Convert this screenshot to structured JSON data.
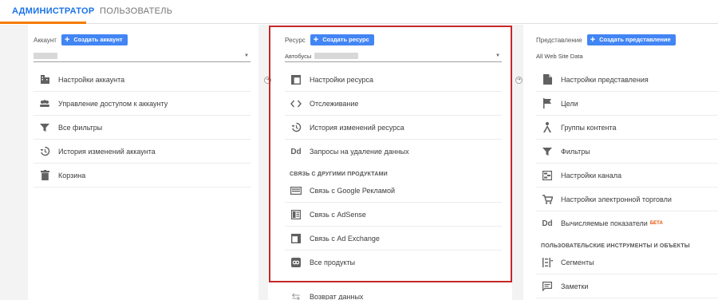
{
  "tabs": {
    "admin": "АДМИНИСТРАТОР",
    "user": "ПОЛЬЗОВАТЕЛЬ"
  },
  "account": {
    "title": "Аккаунт",
    "create_label": "Создать аккаунт",
    "items": [
      {
        "label": "Настройки аккаунта",
        "icon": "building-icon"
      },
      {
        "label": "Управление доступом к аккаунту",
        "icon": "people-icon"
      },
      {
        "label": "Все фильтры",
        "icon": "filter-icon"
      },
      {
        "label": "История изменений аккаунта",
        "icon": "history-icon"
      },
      {
        "label": "Корзина",
        "icon": "trash-icon"
      }
    ]
  },
  "property": {
    "title": "Ресурс",
    "create_label": "Создать ресурс",
    "selected": "Автобусы",
    "items": [
      {
        "label": "Настройки ресурса",
        "icon": "window-icon"
      },
      {
        "label": "Отслеживание",
        "icon": "code-icon"
      },
      {
        "label": "История изменений ресурса",
        "icon": "history-icon"
      },
      {
        "label": "Запросы на удаление данных",
        "icon": "dd-icon"
      }
    ],
    "links_header": "СВЯЗЬ С ДРУГИМИ ПРОДУКТАМИ",
    "links": [
      {
        "label": "Связь с Google Рекламой",
        "icon": "ads-icon"
      },
      {
        "label": "Связь с AdSense",
        "icon": "adsense-icon"
      },
      {
        "label": "Связь с Ad Exchange",
        "icon": "adexchange-icon"
      },
      {
        "label": "Все продукты",
        "icon": "link-icon"
      }
    ],
    "cut_item": "Возврат данных"
  },
  "view": {
    "title": "Представление",
    "create_label": "Создать представление",
    "selected": "All Web Site Data",
    "items": [
      {
        "label": "Настройки представления",
        "icon": "document-icon"
      },
      {
        "label": "Цели",
        "icon": "flag-icon"
      },
      {
        "label": "Группы контента",
        "icon": "person-icon"
      },
      {
        "label": "Фильтры",
        "icon": "filter-icon"
      },
      {
        "label": "Настройки канала",
        "icon": "channel-icon"
      },
      {
        "label": "Настройки электронной торговли",
        "icon": "cart-icon"
      },
      {
        "label": "Вычисляемые показатели",
        "icon": "dd-icon",
        "badge": "БЕТА"
      }
    ],
    "tools_header": "ПОЛЬЗОВАТЕЛЬСКИЕ ИНСТРУМЕНТЫ И ОБЪЕКТЫ",
    "tools": [
      {
        "label": "Сегменты",
        "icon": "segments-icon"
      },
      {
        "label": "Заметки",
        "icon": "comment-icon"
      }
    ]
  },
  "colors": {
    "accent_blue": "#4285f4",
    "tab_underline": "#f57c00",
    "highlight_border": "#c62828"
  }
}
